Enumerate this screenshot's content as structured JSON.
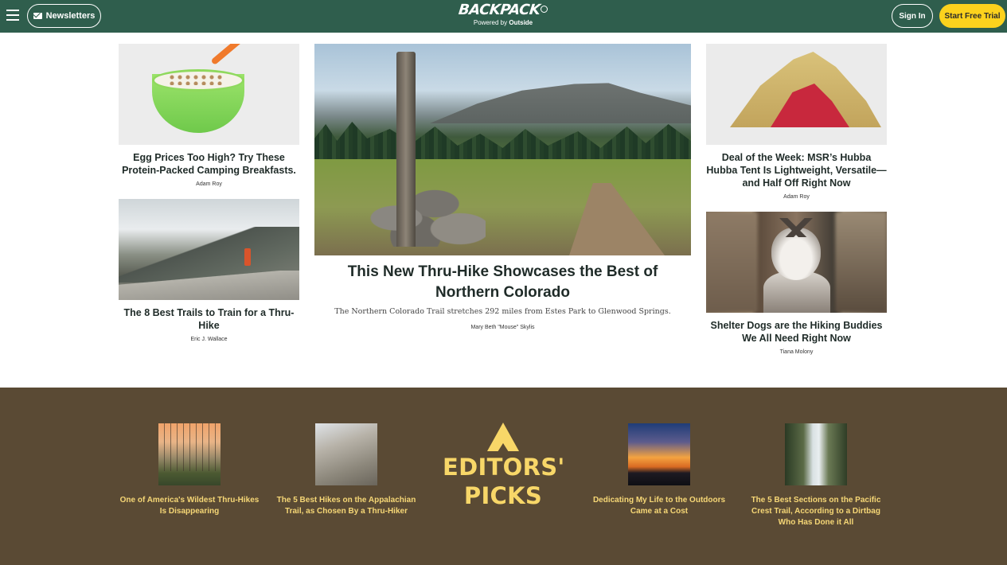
{
  "header": {
    "newsletters_label": "Newsletters",
    "logo_text": "BACKPACK",
    "logo_powered": "Powered by",
    "logo_brand": "Outside",
    "signin_label": "Sign In",
    "trial_label": "Start Free Trial"
  },
  "colors": {
    "header_bg": "#2f5e4d",
    "trial_button": "#fcd21d",
    "picks_bg": "#5a4a34",
    "picks_text": "#f6d776"
  },
  "articles": {
    "left_top": {
      "title": "Egg Prices Too High? Try These Protein-Packed Camping Breakfasts.",
      "author": "Adam Roy"
    },
    "left_bottom": {
      "title": "The 8 Best Trails to Train for a Thru-Hike",
      "author": "Eric J. Wallace"
    },
    "hero": {
      "title": "This New Thru-Hike Showcases the Best of Northern Colorado",
      "dek": "The Northern Colorado Trail stretches 292 miles from Estes Park to Glenwood Springs.",
      "author": "Mary Beth \"Mouse\" Skylis"
    },
    "right_top": {
      "title": "Deal of the Week: MSR’s Hubba Hubba Tent Is Lightweight, Versatile—and Half Off Right Now",
      "author": "Adam Roy"
    },
    "right_bottom": {
      "title": "Shelter Dogs are the Hiking Buddies We All Need Right Now",
      "author": "Tiana Molony"
    }
  },
  "editors_picks": {
    "heading_line1": "EDITORS'",
    "heading_line2": "PICKS",
    "items": [
      {
        "title": "One of America's Wildest Thru-Hikes Is Disappearing"
      },
      {
        "title": "The 5 Best Hikes on the Appalachian Trail, as Chosen By a Thru-Hiker"
      },
      {
        "title": "Dedicating My Life to the Outdoors Came at a Cost"
      },
      {
        "title": "The 5 Best Sections on the Pacific Crest Trail, According to a Dirtbag Who Has Done it All"
      }
    ]
  }
}
